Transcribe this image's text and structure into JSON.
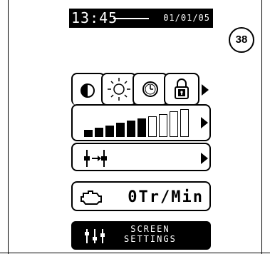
{
  "status_bar": {
    "time": "13:45",
    "date": "01/01/05"
  },
  "badge": {
    "number": "38"
  },
  "tabs": [
    {
      "icon": "contrast-icon"
    },
    {
      "icon": "brightness-icon"
    },
    {
      "icon": "clock-icon"
    },
    {
      "icon": "lock-icon"
    }
  ],
  "brightness_level": {
    "filled": 6,
    "total": 10
  },
  "engine": {
    "value": "0Tr/Min"
  },
  "settings_button": {
    "line1": "SCREEN",
    "line2": "SETTINGS"
  }
}
